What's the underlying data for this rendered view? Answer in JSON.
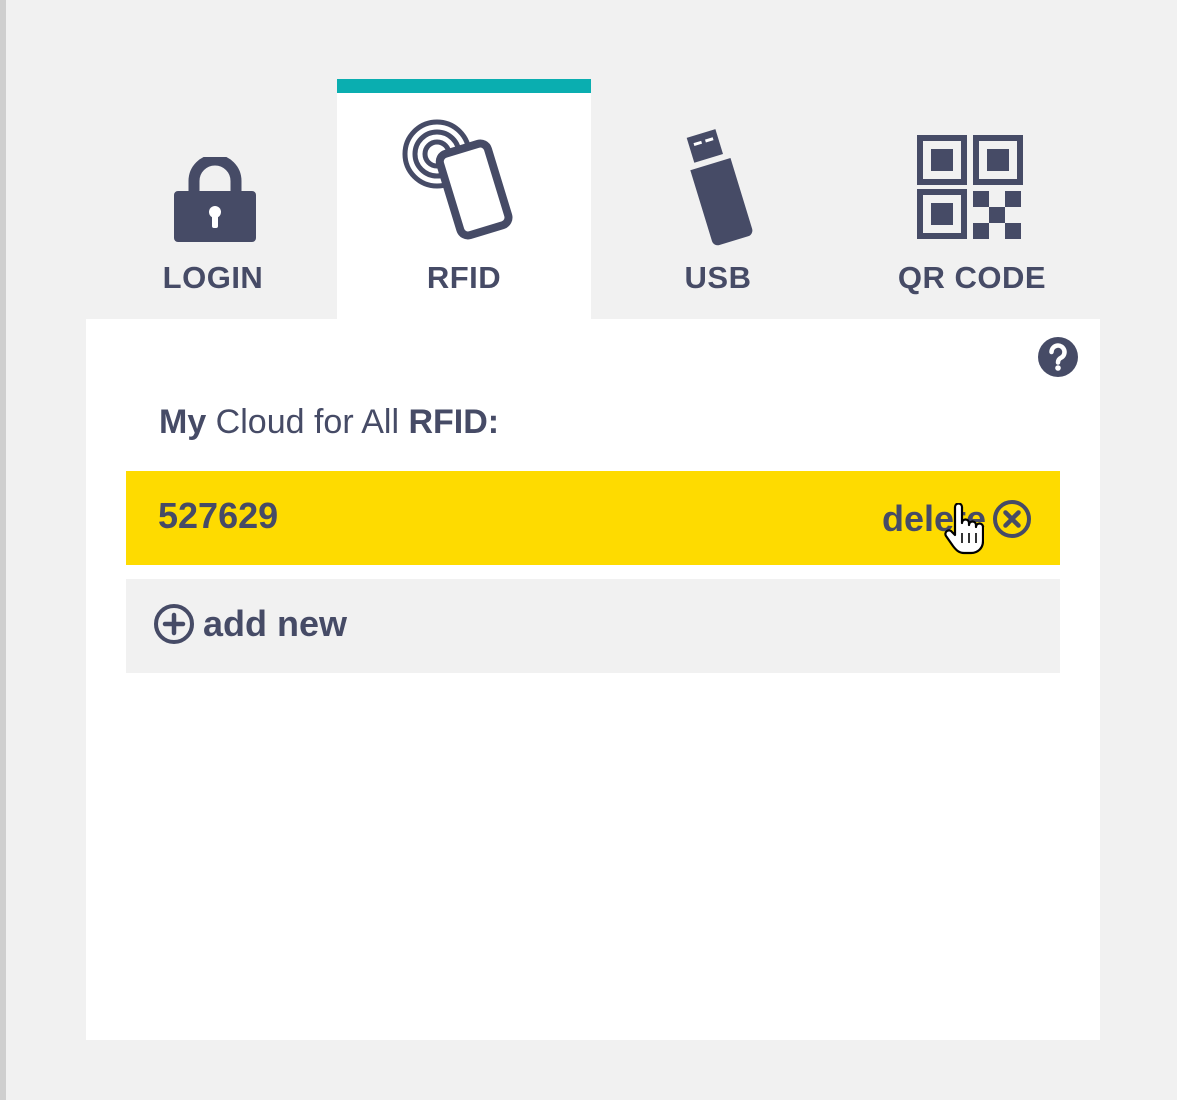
{
  "tabs": [
    {
      "label": "LOGIN",
      "icon": "lock-icon",
      "active": false
    },
    {
      "label": "RFID",
      "icon": "rfid-card-icon",
      "active": true
    },
    {
      "label": "USB",
      "icon": "usb-stick-icon",
      "active": false
    },
    {
      "label": "QR CODE",
      "icon": "qr-code-icon",
      "active": false
    }
  ],
  "panel": {
    "title_strong1": "My",
    "title_mid": " Cloud for All ",
    "title_strong2": "RFID:",
    "help_icon": "question-icon"
  },
  "rfid_entry": {
    "value": "527629",
    "delete_label": "delete",
    "delete_icon": "close-circle-icon"
  },
  "add_new": {
    "label": "add new",
    "icon": "plus-circle-icon"
  },
  "colors": {
    "accent": "#0aaeb0",
    "highlight": "#fedb00",
    "text": "#464b66",
    "background": "#f1f1f1",
    "panel": "#ffffff"
  }
}
